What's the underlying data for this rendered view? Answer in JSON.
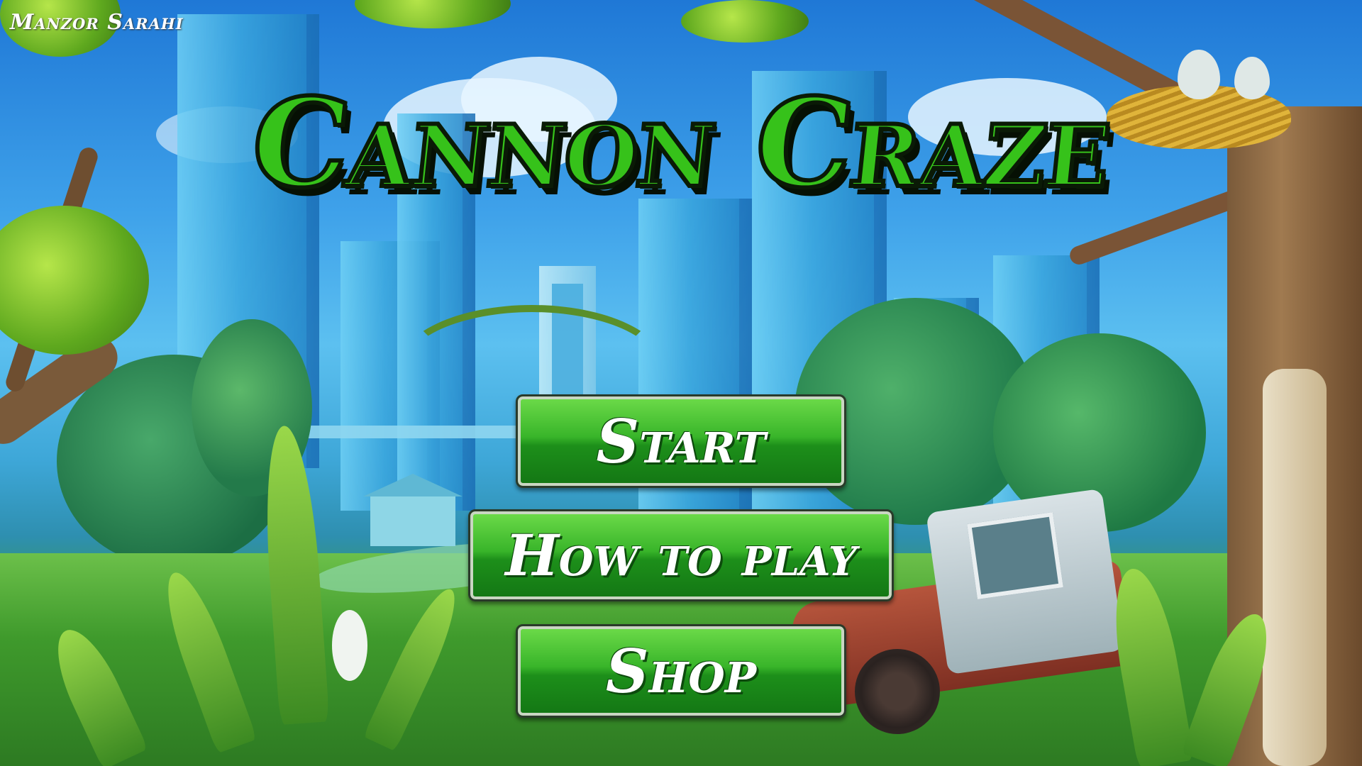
{
  "game": {
    "title": "Cannon Craze",
    "watermark": "Manzor Sarahi"
  },
  "menu": {
    "start_label": "Start",
    "how_to_play_label": "How to play",
    "shop_label": "Shop"
  },
  "colors": {
    "title_green": "#36c21a",
    "button_green": "#1d8f1a",
    "button_text": "#ffffff"
  }
}
